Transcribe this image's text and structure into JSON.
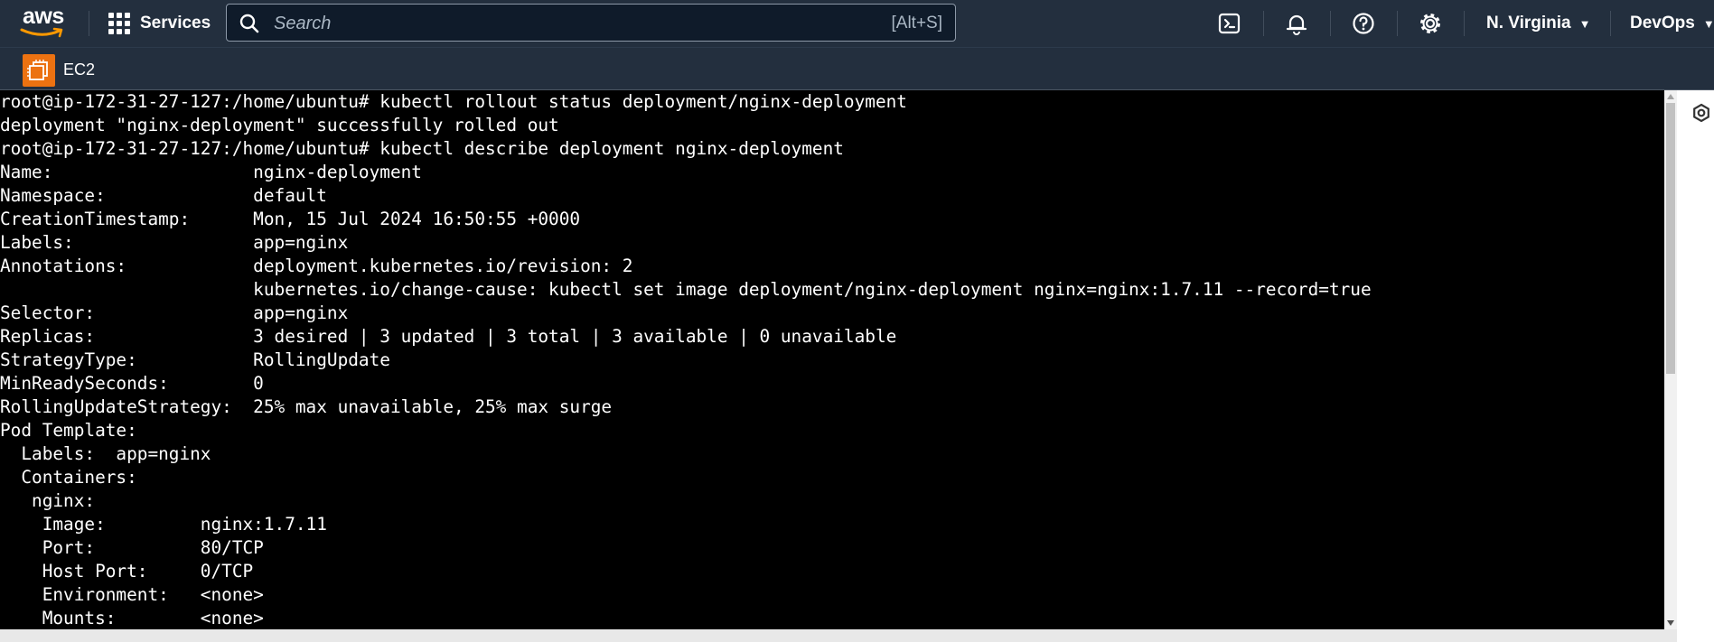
{
  "header": {
    "logo_text": "aws",
    "services_label": "Services",
    "search_placeholder": "Search",
    "search_shortcut": "[Alt+S]",
    "region_label": "N. Virginia",
    "account_label": "DevOps",
    "icons": [
      "cloudshell-icon",
      "notifications-icon",
      "help-icon",
      "settings-icon"
    ]
  },
  "service_bar": {
    "service_name": "EC2",
    "accent_color": "#ec7211"
  },
  "terminal": {
    "lines": [
      "root@ip-172-31-27-127:/home/ubuntu# kubectl rollout status deployment/nginx-deployment",
      "deployment \"nginx-deployment\" successfully rolled out",
      "root@ip-172-31-27-127:/home/ubuntu# kubectl describe deployment nginx-deployment",
      "Name:                   nginx-deployment",
      "Namespace:              default",
      "CreationTimestamp:      Mon, 15 Jul 2024 16:50:55 +0000",
      "Labels:                 app=nginx",
      "Annotations:            deployment.kubernetes.io/revision: 2",
      "                        kubernetes.io/change-cause: kubectl set image deployment/nginx-deployment nginx=nginx:1.7.11 --record=true",
      "Selector:               app=nginx",
      "Replicas:               3 desired | 3 updated | 3 total | 3 available | 0 unavailable",
      "StrategyType:           RollingUpdate",
      "MinReadySeconds:        0",
      "RollingUpdateStrategy:  25% max unavailable, 25% max surge",
      "Pod Template:",
      "  Labels:  app=nginx",
      "  Containers:",
      "   nginx:",
      "    Image:         nginx:1.7.11",
      "    Port:          80/TCP",
      "    Host Port:     0/TCP",
      "    Environment:   <none>",
      "    Mounts:        <none>"
    ]
  },
  "colors": {
    "nav_bg": "#232f3e",
    "terminal_bg": "#000000",
    "terminal_fg": "#ffffff"
  }
}
